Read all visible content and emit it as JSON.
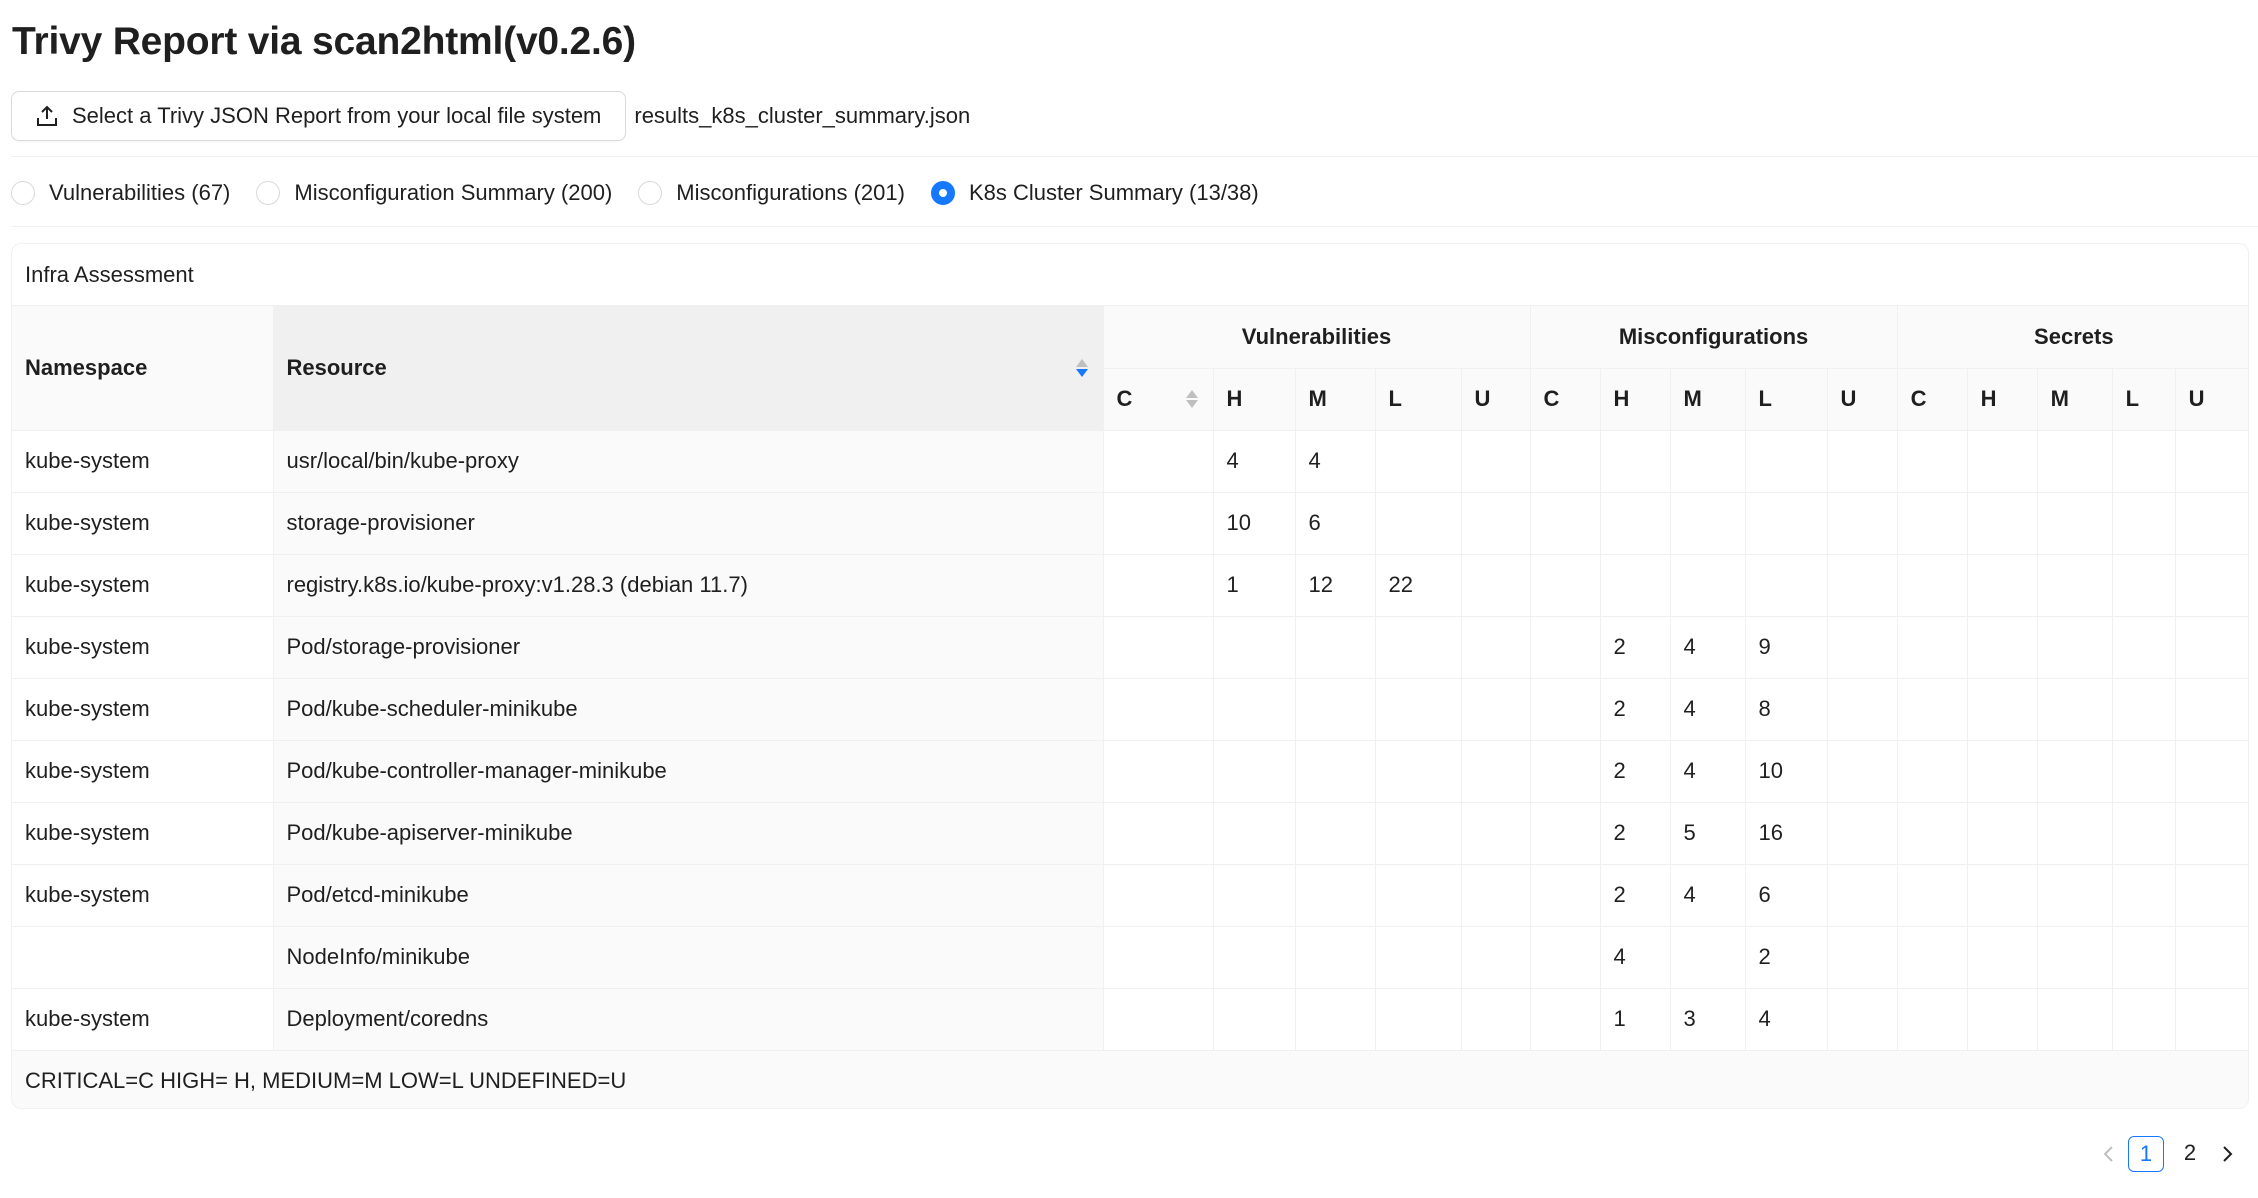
{
  "page": {
    "title": "Trivy Report via scan2html(v0.2.6)"
  },
  "upload": {
    "button_label": "Select a Trivy JSON Report from your local file system",
    "filename": "results_k8s_cluster_summary.json"
  },
  "tabs": [
    {
      "label": "Vulnerabilities (67)",
      "checked": false
    },
    {
      "label": "Misconfiguration Summary (200)",
      "checked": false
    },
    {
      "label": "Misconfigurations (201)",
      "checked": false
    },
    {
      "label": "K8s Cluster Summary (13/38)",
      "checked": true
    }
  ],
  "table": {
    "caption": "Infra Assessment",
    "headers": {
      "namespace": "Namespace",
      "resource": "Resource",
      "groups": [
        "Vulnerabilities",
        "Misconfigurations",
        "Secrets"
      ],
      "sub": [
        "C",
        "H",
        "M",
        "L",
        "U"
      ]
    },
    "rows": [
      {
        "namespace": "kube-system",
        "resource": "usr/local/bin/kube-proxy",
        "values": [
          "",
          "4",
          "4",
          "",
          "",
          "",
          "",
          "",
          "",
          "",
          "",
          "",
          "",
          "",
          ""
        ]
      },
      {
        "namespace": "kube-system",
        "resource": "storage-provisioner",
        "values": [
          "",
          "10",
          "6",
          "",
          "",
          "",
          "",
          "",
          "",
          "",
          "",
          "",
          "",
          "",
          ""
        ]
      },
      {
        "namespace": "kube-system",
        "resource": "registry.k8s.io/kube-proxy:v1.28.3 (debian 11.7)",
        "values": [
          "",
          "1",
          "12",
          "22",
          "",
          "",
          "",
          "",
          "",
          "",
          "",
          "",
          "",
          "",
          ""
        ]
      },
      {
        "namespace": "kube-system",
        "resource": "Pod/storage-provisioner",
        "values": [
          "",
          "",
          "",
          "",
          "",
          "",
          "2",
          "4",
          "9",
          "",
          "",
          "",
          "",
          "",
          ""
        ]
      },
      {
        "namespace": "kube-system",
        "resource": "Pod/kube-scheduler-minikube",
        "values": [
          "",
          "",
          "",
          "",
          "",
          "",
          "2",
          "4",
          "8",
          "",
          "",
          "",
          "",
          "",
          ""
        ]
      },
      {
        "namespace": "kube-system",
        "resource": "Pod/kube-controller-manager-minikube",
        "values": [
          "",
          "",
          "",
          "",
          "",
          "",
          "2",
          "4",
          "10",
          "",
          "",
          "",
          "",
          "",
          ""
        ]
      },
      {
        "namespace": "kube-system",
        "resource": "Pod/kube-apiserver-minikube",
        "values": [
          "",
          "",
          "",
          "",
          "",
          "",
          "2",
          "5",
          "16",
          "",
          "",
          "",
          "",
          "",
          ""
        ]
      },
      {
        "namespace": "kube-system",
        "resource": "Pod/etcd-minikube",
        "values": [
          "",
          "",
          "",
          "",
          "",
          "",
          "2",
          "4",
          "6",
          "",
          "",
          "",
          "",
          "",
          ""
        ]
      },
      {
        "namespace": "",
        "resource": "NodeInfo/minikube",
        "values": [
          "",
          "",
          "",
          "",
          "",
          "",
          "4",
          "",
          "2",
          "",
          "",
          "",
          "",
          "",
          ""
        ]
      },
      {
        "namespace": "kube-system",
        "resource": "Deployment/coredns",
        "values": [
          "",
          "",
          "",
          "",
          "",
          "",
          "1",
          "3",
          "4",
          "",
          "",
          "",
          "",
          "",
          ""
        ]
      }
    ],
    "footer": "CRITICAL=C HIGH= H, MEDIUM=M LOW=L UNDEFINED=U"
  },
  "pagination": {
    "pages": [
      "1",
      "2"
    ],
    "current": "1",
    "prev_icon": "chevron-left-icon",
    "next_icon": "chevron-right-icon"
  },
  "colors": {
    "accent": "#1677ff",
    "border": "#f0f0f0",
    "header_bg": "#fafafa"
  }
}
